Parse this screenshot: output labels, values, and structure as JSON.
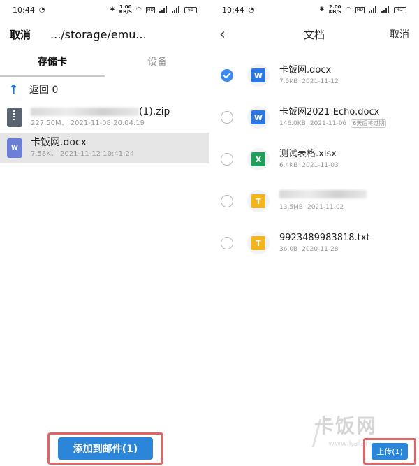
{
  "left": {
    "status": {
      "time": "10:44",
      "speed": "1.00\nKB/S",
      "battery": "61"
    },
    "header": {
      "cancel": "取消",
      "path": ".../storage/emu..."
    },
    "tabs": [
      {
        "label": "存储卡"
      },
      {
        "label": "设备"
      }
    ],
    "back": {
      "label": "返回 0"
    },
    "files": [
      {
        "name": "(1).zip",
        "meta": "227.50M、 2021-11-08 20:04:19"
      },
      {
        "name": "卡饭网.docx",
        "meta": "7.58K、 2021-11-12 10:41:24"
      }
    ],
    "add_button": "添加到邮件(1)"
  },
  "right": {
    "status": {
      "time": "10:44",
      "speed": "2.00\nKB/S",
      "battery": "62"
    },
    "header": {
      "back": "‹",
      "title": "文档",
      "cancel": "取消"
    },
    "files": [
      {
        "name": "卡饭网.docx",
        "size": "7.5KB",
        "date": "2021-11-12",
        "tag": "",
        "icon": "W",
        "checked": true
      },
      {
        "name": "卡饭网2021-Echo.docx",
        "size": "146.0KB",
        "date": "2021-11-06",
        "tag": "6天后将过期",
        "icon": "W",
        "checked": false
      },
      {
        "name": "测试表格.xlsx",
        "size": "6.4KB",
        "date": "2021-11-03",
        "tag": "",
        "icon": "X",
        "checked": false
      },
      {
        "name": "",
        "size": "13.5MB",
        "date": "2021-11-02",
        "tag": "",
        "icon": "T",
        "checked": false
      },
      {
        "name": "9923489983818.txt",
        "size": "36.0B",
        "date": "2020-11-28",
        "tag": "",
        "icon": "T",
        "checked": false
      }
    ],
    "upload_button": "上传(1)"
  },
  "watermark": {
    "brand": "卡饭网",
    "url": "www.kafan.cn"
  }
}
